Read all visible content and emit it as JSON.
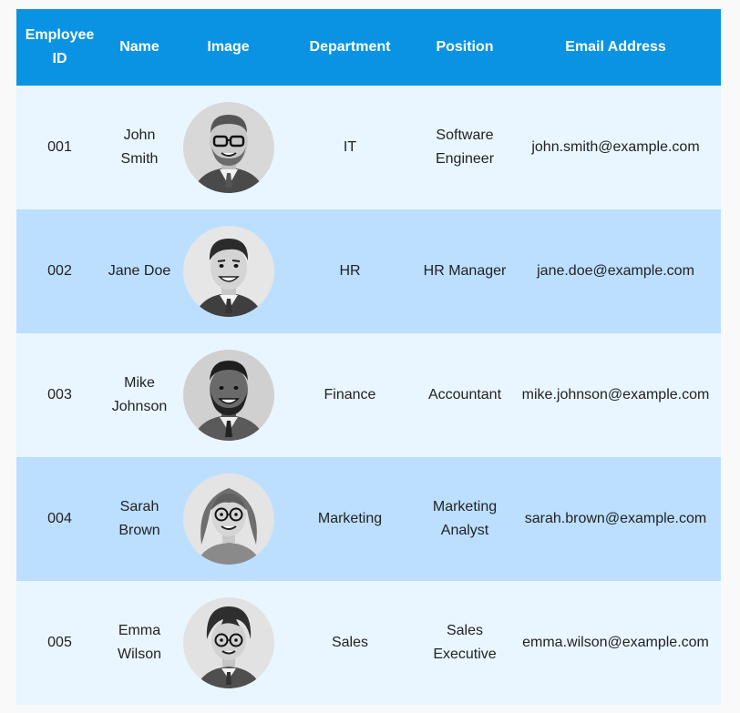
{
  "colors": {
    "header_bg": "#0b93e3",
    "row_light": "#e9f6ff",
    "row_dark": "#bcdfff",
    "page_bg": "#f9f9f9"
  },
  "table": {
    "headers": [
      "Employee ID",
      "Name",
      "Image",
      "Department",
      "Position",
      "Email Address"
    ],
    "rows": [
      {
        "id": "001",
        "name": "John Smith",
        "department": "IT",
        "position": "Software Engineer",
        "email": "john.smith@example.com",
        "avatar_icon": "man-with-glasses-beard-avatar"
      },
      {
        "id": "002",
        "name": "Jane Doe",
        "department": "HR",
        "position": "HR Manager",
        "email": "jane.doe@example.com",
        "avatar_icon": "smiling-man-avatar"
      },
      {
        "id": "003",
        "name": "Mike Johnson",
        "department": "Finance",
        "position": "Accountant",
        "email": "mike.johnson@example.com",
        "avatar_icon": "bearded-man-avatar"
      },
      {
        "id": "004",
        "name": "Sarah Brown",
        "department": "Marketing",
        "position": "Marketing Analyst",
        "email": "sarah.brown@example.com",
        "avatar_icon": "woman-with-glasses-avatar"
      },
      {
        "id": "005",
        "name": "Emma Wilson",
        "department": "Sales",
        "position": "Sales Executive",
        "email": "emma.wilson@example.com",
        "avatar_icon": "person-with-round-glasses-avatar"
      }
    ]
  }
}
